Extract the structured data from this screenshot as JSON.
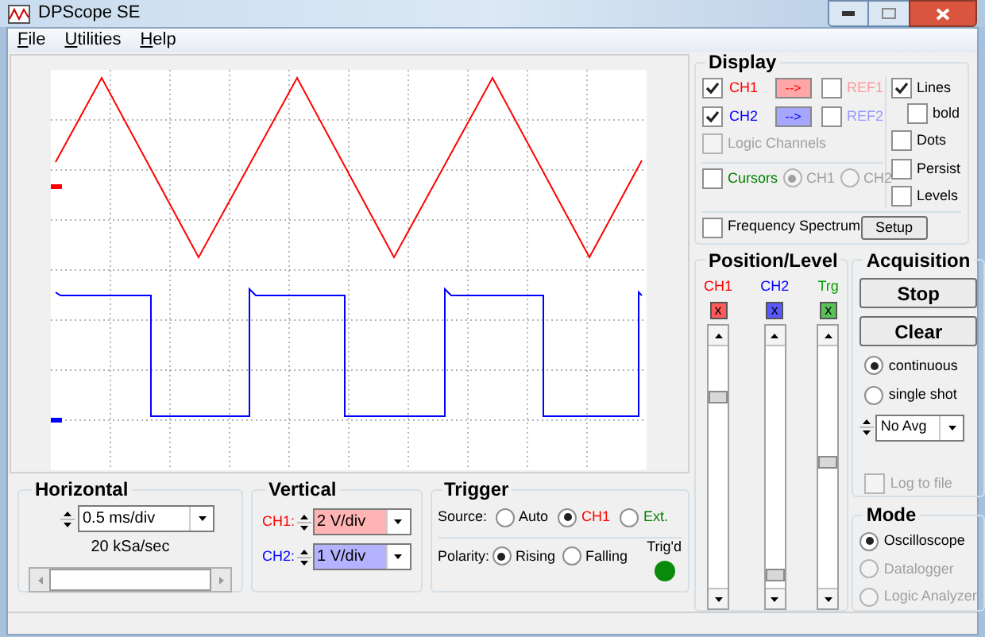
{
  "window": {
    "title": "DPScope SE"
  },
  "menu": [
    {
      "label": "File"
    },
    {
      "label": "Utilities"
    },
    {
      "label": "Help"
    }
  ],
  "display": {
    "title": "Display",
    "channels": [
      {
        "label": "CH1",
        "checked": true,
        "color": "#ff0000",
        "button": "-->",
        "ref": {
          "label": "REF1",
          "checked": false
        }
      },
      {
        "label": "CH2",
        "checked": true,
        "color": "#0000ff",
        "button": "-->",
        "ref": {
          "label": "REF2",
          "checked": false
        }
      }
    ],
    "logic_channels": {
      "label": "Logic Channels",
      "checked": false,
      "disabled": true
    },
    "cursors": {
      "label": "Cursors",
      "checked": false,
      "options": [
        {
          "label": "CH1",
          "selected": true
        },
        {
          "label": "CH2",
          "selected": false
        }
      ]
    },
    "options": [
      {
        "label": "Lines",
        "checked": true,
        "children": [
          {
            "label": "bold",
            "checked": false
          }
        ]
      },
      {
        "label": "Dots",
        "checked": false
      },
      {
        "label": "Persist",
        "checked": false
      },
      {
        "label": "Levels",
        "checked": false
      }
    ],
    "frequency_spectrum": {
      "label": "Frequency Spectrum",
      "checked": false
    },
    "setup_button": "Setup"
  },
  "position_level": {
    "title": "Position/Level",
    "sliders": [
      {
        "label": "CH1",
        "button": "x",
        "color": "#ff0000",
        "level": 0.76
      },
      {
        "label": "CH2",
        "button": "x",
        "color": "#0000ff",
        "level": 0.1
      },
      {
        "label": "Trg",
        "button": "x",
        "color": "#00a000",
        "level": 0.52
      }
    ]
  },
  "acquisition": {
    "title": "Acquisition",
    "buttons": [
      "Stop",
      "Clear"
    ],
    "modes": [
      {
        "label": "continuous",
        "selected": true
      },
      {
        "label": "single shot",
        "selected": false
      }
    ],
    "averaging": "No Avg",
    "log_to_file": {
      "label": "Log to file",
      "checked": false,
      "disabled": true
    }
  },
  "mode": {
    "title": "Mode",
    "options": [
      {
        "label": "Oscilloscope",
        "selected": true,
        "disabled": false
      },
      {
        "label": "Datalogger",
        "selected": false,
        "disabled": true
      },
      {
        "label": "Logic Analyzer",
        "selected": false,
        "disabled": true
      }
    ]
  },
  "horizontal": {
    "title": "Horizontal",
    "timebase": "0.5 ms/div",
    "sample_rate": "20 kSa/sec"
  },
  "vertical": {
    "title": "Vertical",
    "channels": [
      {
        "label": "CH1:",
        "scale": "2 V/div",
        "color": "#ff0000"
      },
      {
        "label": "CH2:",
        "scale": "1 V/div",
        "color": "#0000ff"
      }
    ]
  },
  "trigger": {
    "title": "Trigger",
    "source_label": "Source:",
    "sources": [
      {
        "label": "Auto",
        "selected": false,
        "color": "#000000"
      },
      {
        "label": "CH1",
        "selected": true,
        "color": "#ff0000"
      },
      {
        "label": "Ext.",
        "selected": false,
        "color": "#008000"
      }
    ],
    "polarity_label": "Polarity:",
    "polarities": [
      {
        "label": "Rising",
        "selected": true
      },
      {
        "label": "Falling",
        "selected": false
      }
    ],
    "status": {
      "label": "Trig'd",
      "on": true
    }
  }
}
